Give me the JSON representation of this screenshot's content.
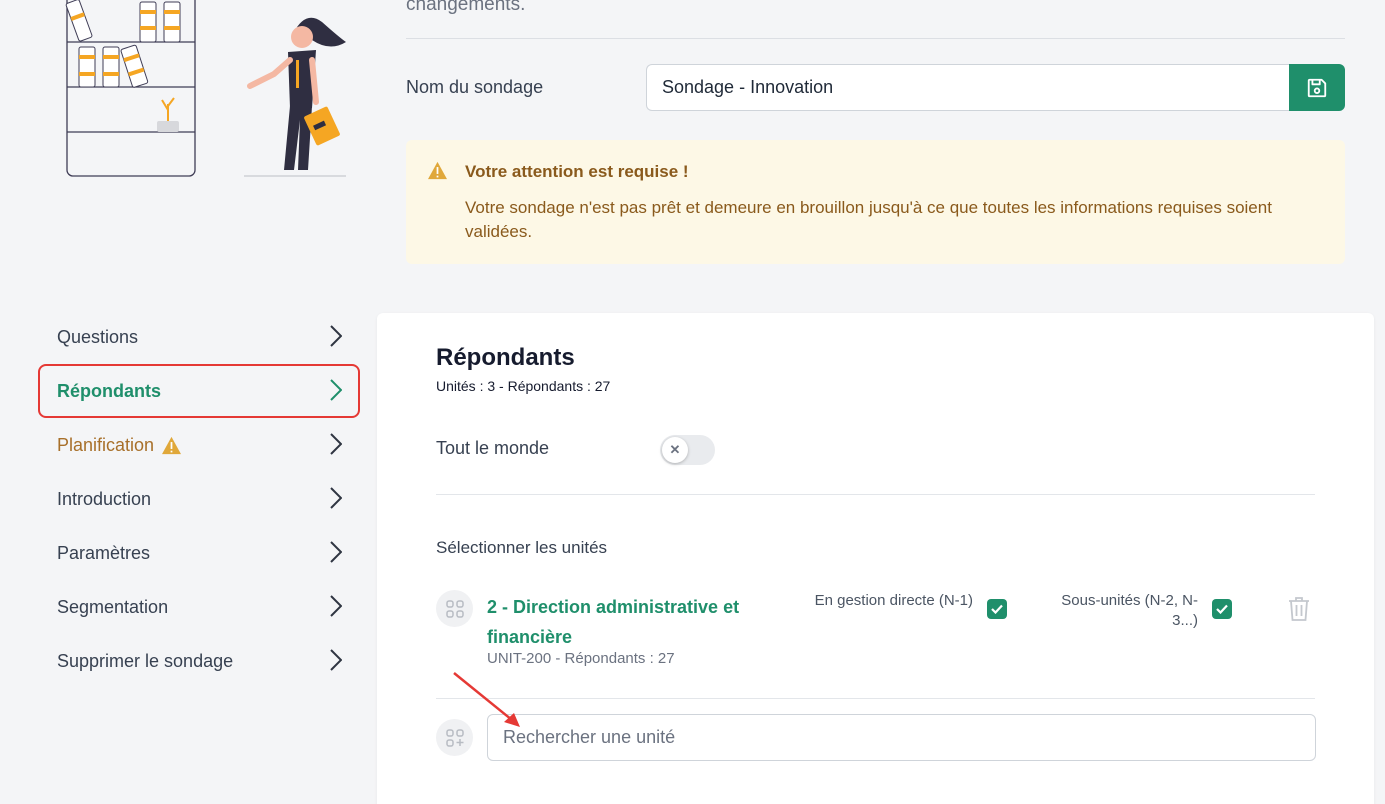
{
  "header": {
    "intro_text": "changements.",
    "survey_name_label": "Nom du sondage",
    "survey_name_value": "Sondage - Innovation"
  },
  "alert": {
    "title": "Votre attention est requise !",
    "message": "Votre sondage n'est pas prêt et demeure en brouillon jusqu'à ce que toutes les informations requises soient validées."
  },
  "sidebar": {
    "items": [
      {
        "label": "Questions"
      },
      {
        "label": "Répondants",
        "active": true
      },
      {
        "label": "Planification",
        "warning": true
      },
      {
        "label": "Introduction"
      },
      {
        "label": "Paramètres"
      },
      {
        "label": "Segmentation"
      },
      {
        "label": "Supprimer le sondage"
      }
    ]
  },
  "respondents": {
    "title": "Répondants",
    "summary": "Unités : 3 - Répondants : 27",
    "everyone_label": "Tout le monde",
    "everyone_enabled": false,
    "select_units_label": "Sélectionner les unités",
    "units": [
      {
        "name": "2 - Direction administrative et financière",
        "meta": "UNIT-200 - Répondants : 27",
        "direct_label": "En gestion directe (N-1)",
        "direct_checked": true,
        "sub_label": "Sous-unités (N-2, N-3...)",
        "sub_checked": true
      }
    ],
    "search_placeholder": "Rechercher une unité"
  },
  "colors": {
    "accent": "#1f8f6b",
    "warning": "#e0a83a",
    "highlight": "#e53935",
    "alert_bg": "#fdf8e6"
  }
}
